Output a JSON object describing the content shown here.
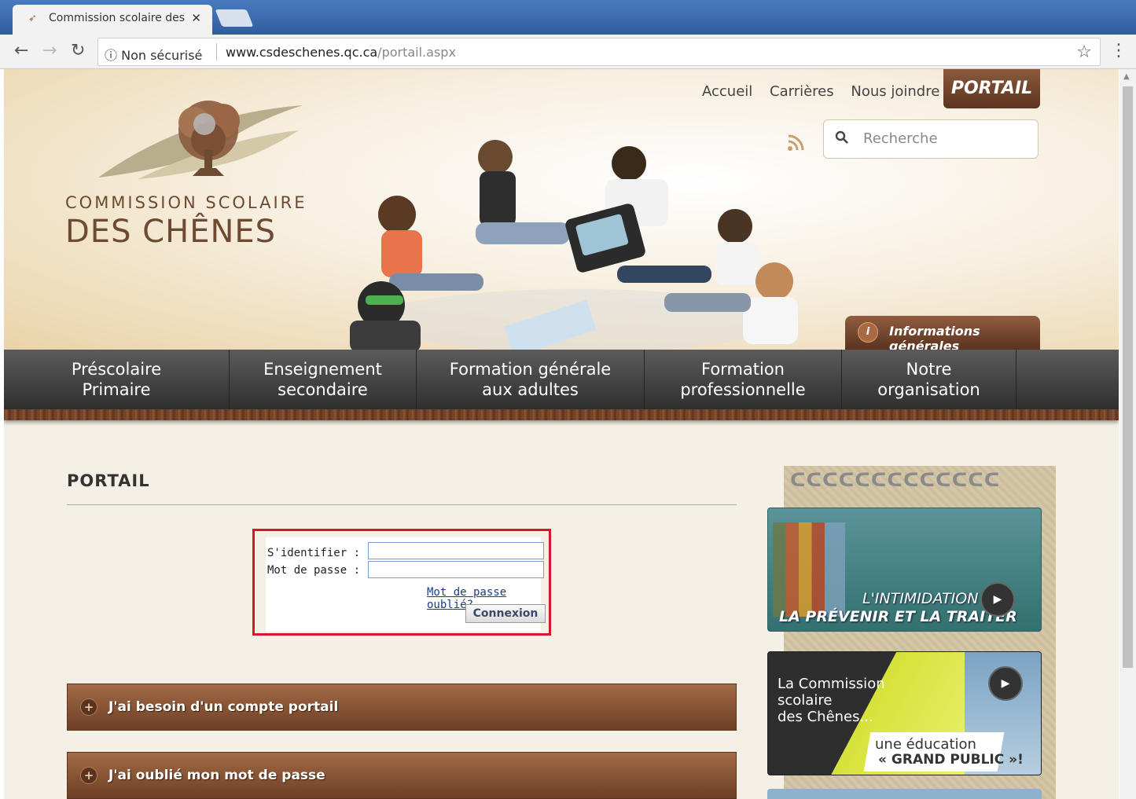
{
  "browser": {
    "tab_title": "Commission scolaire des",
    "tab_close": "✕",
    "security_label": "Non sécurisé",
    "url_host": "www.csdeschenes.qc.ca",
    "url_path": "/portail.aspx"
  },
  "logo": {
    "line1": "COMMISSION SCOLAIRE",
    "line2": "DES CHÊNES"
  },
  "toplinks": [
    "Accueil",
    "Carrières",
    "Nous joindre"
  ],
  "portail_tab": "PORTAIL",
  "search": {
    "placeholder": "Recherche"
  },
  "info_tab": {
    "icon": "i",
    "label": "Informations générales"
  },
  "mainnav": [
    {
      "line1": "Préscolaire",
      "line2": "Primaire"
    },
    {
      "line1": "Enseignement",
      "line2": "secondaire"
    },
    {
      "line1": "Formation générale",
      "line2": "aux adultes"
    },
    {
      "line1": "Formation",
      "line2": "professionnelle"
    },
    {
      "line1": "Notre",
      "line2": "organisation"
    }
  ],
  "content": {
    "title": "PORTAIL",
    "login": {
      "user_label": "S'identifier :",
      "password_label": "Mot de passe :",
      "user_value": "",
      "password_value": "",
      "forgot_link": "Mot de passe oublié?",
      "submit": "Connexion"
    },
    "accordions": [
      {
        "label": "J'ai besoin d'un compte portail"
      },
      {
        "label": "J'ai oublié mon mot de passe"
      }
    ]
  },
  "sidebar": {
    "card1": {
      "line1": "L'INTIMIDATION",
      "line2": "LA PRÉVENIR ET LA TRAITER"
    },
    "card2": {
      "text1": "La Commission",
      "text2": "scolaire",
      "text3": "des Chênes...",
      "line1": "une éducation",
      "line2": "« GRAND PUBLIC »!"
    }
  },
  "colors": {
    "brand_brown": "#6d4b32",
    "portail_tab": "#6e3f24",
    "nav_dark": "#3a3a3a",
    "highlight_red": "#d8182a"
  }
}
